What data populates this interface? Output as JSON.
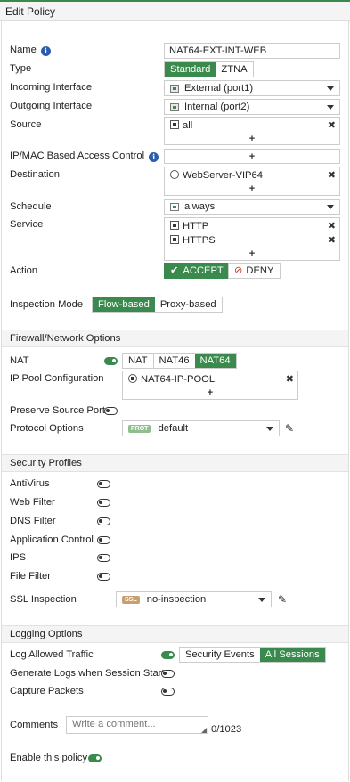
{
  "window": {
    "title": "Edit Policy"
  },
  "form": {
    "name": {
      "label": "Name",
      "value": "NAT64-EXT-INT-WEB"
    },
    "type": {
      "label": "Type",
      "options": [
        "Standard",
        "ZTNA"
      ],
      "selected": "Standard"
    },
    "incoming": {
      "label": "Incoming Interface",
      "value": "External (port1)"
    },
    "outgoing": {
      "label": "Outgoing Interface",
      "value": "Internal (port2)"
    },
    "source": {
      "label": "Source",
      "items": [
        "all"
      ]
    },
    "ipmac": {
      "label": "IP/MAC Based Access Control"
    },
    "destination": {
      "label": "Destination",
      "items": [
        "WebServer-VIP64"
      ]
    },
    "schedule": {
      "label": "Schedule",
      "value": "always"
    },
    "service": {
      "label": "Service",
      "items": [
        "HTTP",
        "HTTPS"
      ]
    },
    "action": {
      "label": "Action",
      "accept": "ACCEPT",
      "deny": "DENY",
      "selected": "ACCEPT"
    },
    "inspection": {
      "label": "Inspection Mode",
      "options": [
        "Flow-based",
        "Proxy-based"
      ],
      "selected": "Flow-based"
    },
    "plus": "+",
    "remove": "✖"
  },
  "firewall": {
    "header": "Firewall/Network Options",
    "nat": {
      "label": "NAT",
      "enabled": true,
      "options": [
        "NAT",
        "NAT46",
        "NAT64"
      ],
      "selected": "NAT64"
    },
    "ippool": {
      "label": "IP Pool Configuration",
      "items": [
        "NAT64-IP-POOL"
      ]
    },
    "preserve_port": {
      "label": "Preserve Source Port",
      "enabled": false
    },
    "protocol": {
      "label": "Protocol Options",
      "badge": "PROT",
      "value": "default"
    }
  },
  "security": {
    "header": "Security Profiles",
    "items": [
      {
        "label": "AntiVirus",
        "enabled": false
      },
      {
        "label": "Web Filter",
        "enabled": false
      },
      {
        "label": "DNS Filter",
        "enabled": false
      },
      {
        "label": "Application Control",
        "enabled": false
      },
      {
        "label": "IPS",
        "enabled": false
      },
      {
        "label": "File Filter",
        "enabled": false
      }
    ],
    "ssl": {
      "label": "SSL Inspection",
      "badge": "SSL",
      "value": "no-inspection"
    }
  },
  "logging": {
    "header": "Logging Options",
    "log_allowed": {
      "label": "Log Allowed Traffic",
      "enabled": true,
      "options": [
        "Security Events",
        "All Sessions"
      ],
      "selected": "All Sessions"
    },
    "gen_logs": {
      "label": "Generate Logs when Session Starts",
      "enabled": false
    },
    "capture": {
      "label": "Capture Packets",
      "enabled": false
    }
  },
  "comments": {
    "label": "Comments",
    "placeholder": "Write a comment...",
    "counter": "0/1023"
  },
  "enable_policy": {
    "label": "Enable this policy",
    "enabled": true
  },
  "colors": {
    "accent": "#3a8a4d",
    "deny": "#c0392b",
    "prot_badge": "#8fbf8f",
    "ssl_badge": "#c8a070",
    "info": "#2a5db0"
  }
}
